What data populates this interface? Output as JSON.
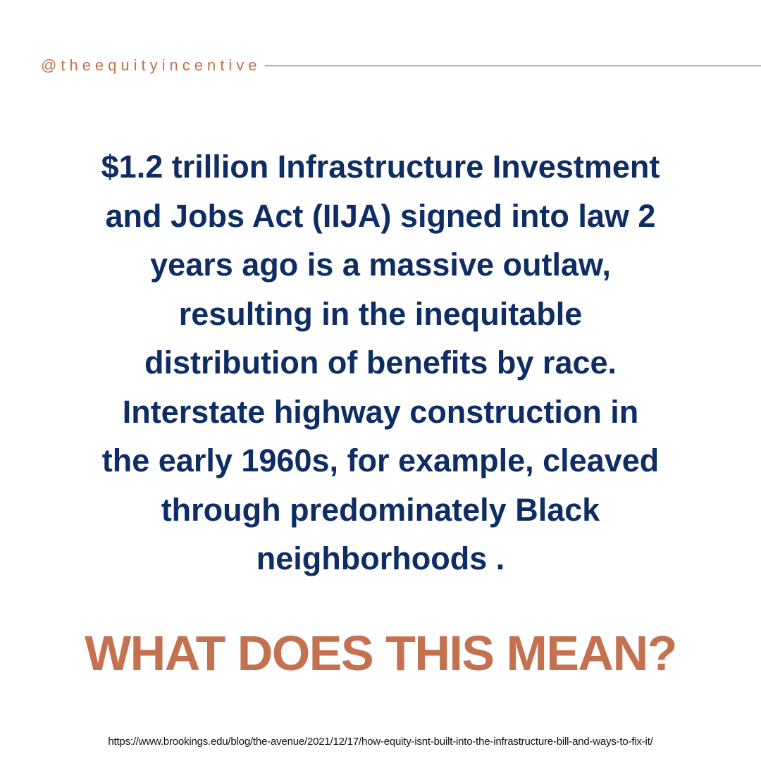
{
  "handle": "@theequityincentive",
  "main_lines": [
    "$1.2 trillion Infrastructure Investment",
    "and Jobs Act (IIJA) signed into law 2",
    "years ago is a massive outlaw,",
    "resulting in the inequitable",
    "distribution of benefits by race.",
    "Interstate highway construction in",
    "the early 1960s, for example, cleaved",
    "through predominately Black",
    "neighborhoods ."
  ],
  "cta": "WHAT DOES THIS MEAN?",
  "source_url": "https://www.brookings.edu/blog/the-avenue/2021/12/17/how-equity-isnt-built-into-the-infrastructure-bill-and-ways-to-fix-it/",
  "colors": {
    "navy_text": "#0e2d64",
    "accent_orange": "#c4714f",
    "rule_line": "#2f4f73",
    "background": "#ffffff"
  }
}
